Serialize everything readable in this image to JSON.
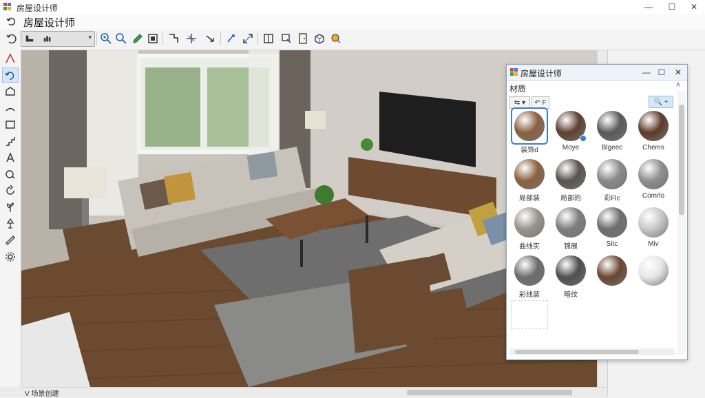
{
  "window": {
    "title": "房屋设计师",
    "minimize": "—",
    "maximize": "☐",
    "close": "✕"
  },
  "app": {
    "title": "房屋设计师"
  },
  "toolbar": {
    "combo": {
      "icon1": "floor-plan-icon",
      "icon2": "chart-icon",
      "arrow": "▾"
    },
    "tools": [
      "zoom-in-icon",
      "zoom-out-icon",
      "pencil-icon",
      "window-icon",
      "wall-tool-icon",
      "dimension-icon",
      "arrow-tool-icon",
      "edit-icon",
      "resize-icon",
      "frame-icon",
      "select-icon",
      "door-icon",
      "furniture-icon"
    ]
  },
  "left_tools": [
    "line-tool-icon",
    "undo-arc-icon",
    "room-tool-icon",
    "arc-tool-icon",
    "rect-tool-icon",
    "stair-tool-icon",
    "text-tool-icon",
    "camera-tool-icon",
    "rotate-tool-icon",
    "plant-tool-icon",
    "lamp-tool-icon",
    "measure-tool-icon",
    "settings-icon"
  ],
  "panel": {
    "title": "房屋设计师",
    "section": "材质",
    "filter1": "⇆ ▾",
    "filter2": "↶ F",
    "search": "🔍 +",
    "tiles": [
      {
        "label": "装饰d",
        "color": "#8a6040",
        "selected": true
      },
      {
        "label": "Moye",
        "color": "#5e4030",
        "selected": false
      },
      {
        "label": "Blgeec",
        "color": "#595959",
        "selected": false
      },
      {
        "label": "Chems",
        "color": "#5c3a28",
        "selected": false
      },
      {
        "label": "局部装",
        "color": "#8c603e",
        "selected": false
      },
      {
        "label": "局部的",
        "color": "#5a5450",
        "selected": false
      },
      {
        "label": "彩Flc",
        "color": "#8a8a8a",
        "selected": false
      },
      {
        "label": "Comrlo",
        "color": "#8e8e8e",
        "selected": false
      },
      {
        "label": "曲线实",
        "color": "#9a948c",
        "selected": false
      },
      {
        "label": "锦展",
        "color": "#7e7e7e",
        "selected": false
      },
      {
        "label": "Sitc",
        "color": "#6e6e6e",
        "selected": false
      },
      {
        "label": "Miv",
        "color": "#c8c8c8",
        "selected": false
      },
      {
        "label": "彩线装",
        "color": "#6c6c6c",
        "selected": false
      },
      {
        "label": "暗纹",
        "color": "#4e4e4e",
        "selected": false
      },
      {
        "label": "",
        "color": "#6a4630",
        "selected": false
      },
      {
        "label": "",
        "color": "#e6e6e6",
        "selected": false
      }
    ]
  },
  "status": {
    "text": "V 场景创建"
  }
}
